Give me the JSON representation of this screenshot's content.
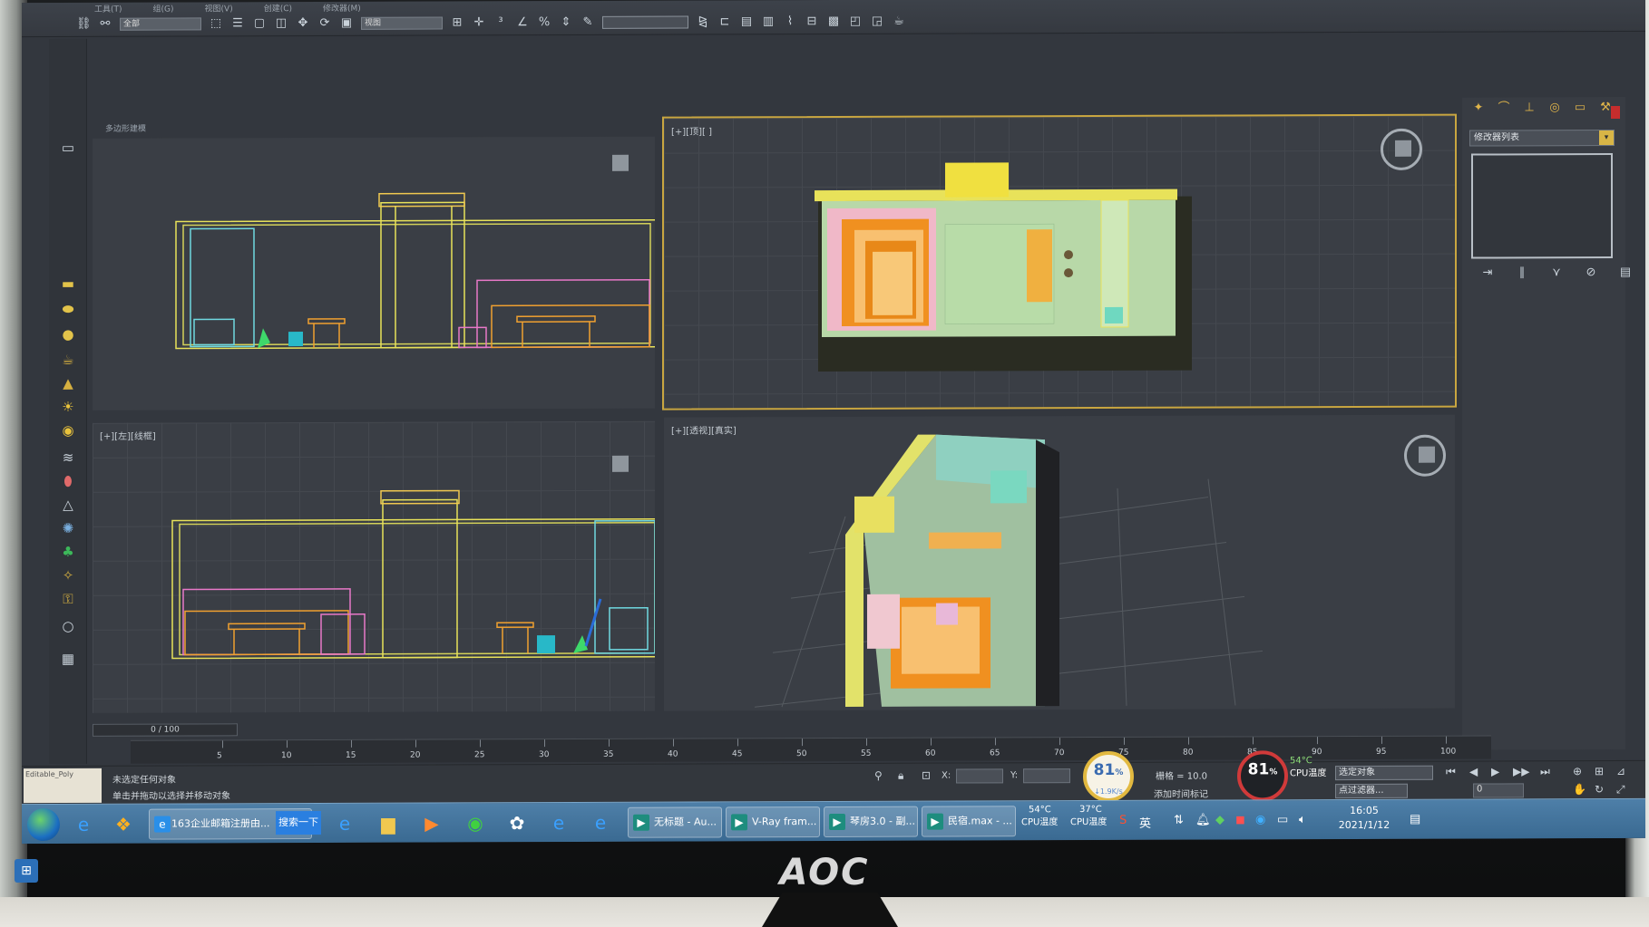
{
  "monitor": {
    "brand": "AOC"
  },
  "app": {
    "menu": [
      "工具(T)",
      "组(G)",
      "视图(V)",
      "创建(C)",
      "修改器(M)"
    ],
    "toolbar_selection_field": "全部",
    "toolbar_view_field": "视图"
  },
  "left_panel": {
    "header": "多边形建模"
  },
  "viewports": {
    "top_left": {
      "label": ""
    },
    "bottom_left": {
      "label": "[+][左][线框]"
    },
    "top_right": {
      "label": "[+][顶][ ]"
    },
    "perspective": {
      "label": "[+][透视][真实]"
    }
  },
  "command_panel": {
    "modifier_list_label": "修改器列表",
    "dropdown_arrow": "▾"
  },
  "timeline": {
    "slider_label": "0 / 100",
    "ticks": [
      "5",
      "10",
      "15",
      "20",
      "25",
      "30",
      "35",
      "40",
      "45",
      "50",
      "55",
      "60",
      "65",
      "70",
      "75",
      "80",
      "85",
      "90",
      "95",
      "100"
    ]
  },
  "status": {
    "object_name": "Editable_Poly",
    "line1": "未选定任何对象",
    "line2": "单击并拖动以选择并移动对象",
    "x_label": "X:",
    "y_label": "Y:",
    "grid_label": "栅格 = 10.0",
    "add_time_tag": "添加时间标记",
    "selection_dropdown": "选定对象",
    "filter_label": "点过滤器...",
    "frame_field": "0"
  },
  "gauges": {
    "left": {
      "percent": "81",
      "unit": "%",
      "speed": "↓1.9K/s"
    },
    "right": {
      "percent": "81",
      "unit": "%",
      "caption": "CPU温度",
      "temp": "54°C"
    }
  },
  "taskbar": {
    "browser_tab": "163企业邮箱注册由...",
    "search_btn": "搜索一下",
    "tasks": [
      "无标题 - Au...",
      "V-Ray fram...",
      "琴房3.0 - 副...",
      "民宿.max - ..."
    ],
    "cpu_temp_1": "54°C",
    "cpu_temp_1_label": "CPU温度",
    "cpu_temp_2": "37°C",
    "cpu_temp_2_label": "CPU温度",
    "time": "16:05",
    "date": "2021/1/12",
    "ime_label": "英"
  },
  "colors": {
    "wire_yellow": "#e8e25a",
    "wire_orange": "#f0a030",
    "wire_pink": "#e878c8",
    "wire_cyan": "#6fd8e0",
    "accent_gold": "#e2b940"
  }
}
